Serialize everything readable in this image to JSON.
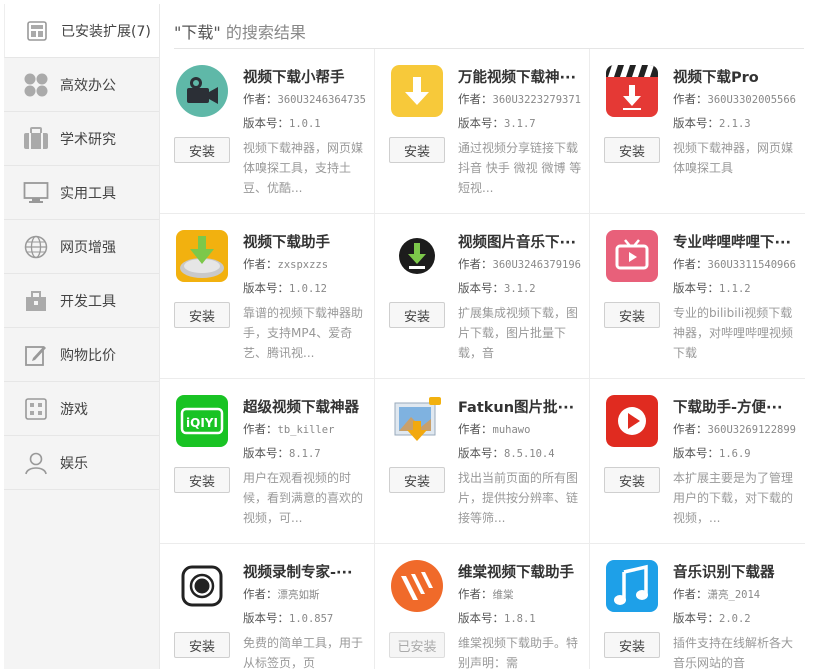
{
  "sidebar": {
    "items": [
      {
        "label": "已安装扩展(7)",
        "icon": "installed-extensions-icon",
        "active": true
      },
      {
        "label": "高效办公",
        "icon": "office-icon"
      },
      {
        "label": "学术研究",
        "icon": "briefcase-icon"
      },
      {
        "label": "实用工具",
        "icon": "monitor-icon"
      },
      {
        "label": "网页增强",
        "icon": "globe-icon"
      },
      {
        "label": "开发工具",
        "icon": "toolbox-icon"
      },
      {
        "label": "购物比价",
        "icon": "edit-icon"
      },
      {
        "label": "游戏",
        "icon": "game-grid-icon"
      },
      {
        "label": "娱乐",
        "icon": "person-icon"
      }
    ]
  },
  "search": {
    "keyword": "\"下载\"",
    "suffix": " 的搜索结果"
  },
  "labels": {
    "author": "作者：",
    "version": "版本号："
  },
  "results": [
    {
      "name": "视频下载小帮手",
      "author": "360U3246364735",
      "version": "1.0.1",
      "desc": "视频下载神器，网页媒体嗅探工具，支持土豆、优酷...",
      "button": "安装",
      "installed": false,
      "icon": "camera-icon",
      "icon_bg": "#5fb8a8"
    },
    {
      "name": "万能视频下载神···",
      "author": "360U3223279371",
      "version": "3.1.7",
      "desc": "通过视频分享链接下载抖音 快手 微视 微博 等短视...",
      "button": "安装",
      "installed": false,
      "icon": "yellow-download-icon",
      "icon_bg": "#f7c93a"
    },
    {
      "name": "视频下载Pro",
      "author": "360U3302005566",
      "version": "2.1.3",
      "desc": "视频下载神器，网页媒体嗅探工具",
      "button": "安装",
      "installed": false,
      "icon": "clapperboard-download-icon",
      "icon_bg": "#e53935"
    },
    {
      "name": "视频下载助手",
      "author": "zxspxzzs",
      "version": "1.0.12",
      "desc": "靠谱的视频下载神器助手，支持MP4、爱奇艺、腾讯视...",
      "button": "安装",
      "installed": false,
      "icon": "funnel-download-icon",
      "icon_bg": "#f2b10f"
    },
    {
      "name": "视频图片音乐下···",
      "author": "360U3246379196",
      "version": "3.1.2",
      "desc": "扩展集成视频下载，图片下载，图片批量下载，音",
      "button": "安装",
      "installed": false,
      "icon": "black-circle-download-icon",
      "icon_bg": "#ffffff"
    },
    {
      "name": "专业哔哩哔哩下···",
      "author": "360U3311540966",
      "version": "1.1.2",
      "desc": "专业的bilibili视频下载神器，对哔哩哔哩视频下载",
      "button": "安装",
      "installed": false,
      "icon": "tv-play-icon",
      "icon_bg": "#e8607a"
    },
    {
      "name": "超级视频下载神器",
      "author": "tb_killer",
      "version": "8.1.7",
      "desc": "用户在观看视频的时候，看到满意的喜欢的视频，可...",
      "button": "安装",
      "installed": false,
      "icon": "iqiyi-icon",
      "icon_bg": "#19c324"
    },
    {
      "name": "Fatkun图片批···",
      "author": "muhawo",
      "version": "8.5.10.4",
      "desc": "找出当前页面的所有图片，提供按分辨率、链接等筛...",
      "button": "安装",
      "installed": false,
      "icon": "picture-download-icon",
      "icon_bg": "#d9e6f2"
    },
    {
      "name": "下载助手-方便···",
      "author": "360U3269122899",
      "version": "1.6.9",
      "desc": "本扩展主要是为了管理用户的下载，对下载的视频，...",
      "button": "安装",
      "installed": false,
      "icon": "red-play-icon",
      "icon_bg": "#e02b20"
    },
    {
      "name": "视频录制专家-···",
      "author": "漂亮如斯",
      "version": "1.0.857",
      "desc": "免费的简单工具，用于从标签页，页",
      "button": "安装",
      "installed": false,
      "icon": "record-icon",
      "icon_bg": "#ffffff"
    },
    {
      "name": "维棠视频下载助手",
      "author": "维棠",
      "version": "1.8.1",
      "desc": "维棠视频下载助手。特别声明：需",
      "button": "已安装",
      "installed": true,
      "icon": "weitang-icon",
      "icon_bg": "#f06a2a"
    },
    {
      "name": "音乐识别下载器",
      "author": "潇亮_2014",
      "version": "2.0.2",
      "desc": "插件支持在线解析各大音乐网站的音",
      "button": "安装",
      "installed": false,
      "icon": "music-note-icon",
      "icon_bg": "#1ea0e8"
    }
  ]
}
